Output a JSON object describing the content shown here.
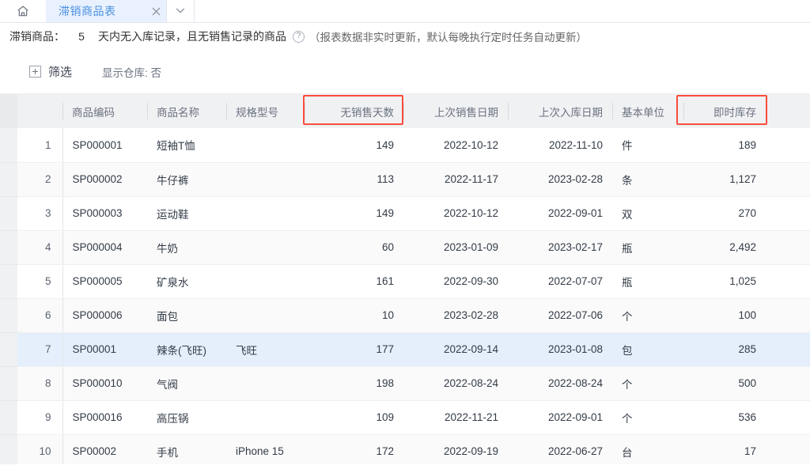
{
  "tabbar": {
    "home_icon": "home-icon",
    "active_tab": "滞销商品表",
    "close_icon": "close-icon",
    "dropdown_icon": "chevron-down-icon"
  },
  "description": {
    "label": "滞销商品：",
    "days_value": "5",
    "middle": "天内无入库记录，且无销售记录的商品",
    "help_icon": "help-circle-icon",
    "note": "（报表数据非实时更新，默认每晚执行定时任务自动更新）"
  },
  "toolbar": {
    "filter_icon": "plus-square-icon",
    "filter_label": "筛选",
    "warehouse_toggle": "显示仓库: 否"
  },
  "table": {
    "columns": [
      {
        "key": "rownum",
        "label": "",
        "align": "num"
      },
      {
        "key": "code",
        "label": "商品编码",
        "align": "left"
      },
      {
        "key": "name",
        "label": "商品名称",
        "align": "left"
      },
      {
        "key": "spec",
        "label": "规格型号",
        "align": "left"
      },
      {
        "key": "days",
        "label": "无销售天数",
        "align": "num"
      },
      {
        "key": "lastsale",
        "label": "上次销售日期",
        "align": "num"
      },
      {
        "key": "lastin",
        "label": "上次入库日期",
        "align": "num"
      },
      {
        "key": "unit",
        "label": "基本单位",
        "align": "left"
      },
      {
        "key": "stock",
        "label": "即时库存",
        "align": "num"
      },
      {
        "key": "tail",
        "label": "",
        "align": "left"
      }
    ],
    "highlighted_columns": [
      "无销售天数",
      "即时库存"
    ],
    "highlight_color": "#fa4d3d",
    "selected_row_index": 7,
    "rows": [
      {
        "rownum": "1",
        "code": "SP000001",
        "name": "短袖T恤",
        "spec": "",
        "days": "149",
        "lastsale": "2022-10-12",
        "lastin": "2022-11-10",
        "unit": "件",
        "stock": "189",
        "tail": ""
      },
      {
        "rownum": "2",
        "code": "SP000002",
        "name": "牛仔裤",
        "spec": "",
        "days": "113",
        "lastsale": "2022-11-17",
        "lastin": "2023-02-28",
        "unit": "条",
        "stock": "1,127",
        "tail": ""
      },
      {
        "rownum": "3",
        "code": "SP000003",
        "name": "运动鞋",
        "spec": "",
        "days": "149",
        "lastsale": "2022-10-12",
        "lastin": "2022-09-01",
        "unit": "双",
        "stock": "270",
        "tail": ""
      },
      {
        "rownum": "4",
        "code": "SP000004",
        "name": "牛奶",
        "spec": "",
        "days": "60",
        "lastsale": "2023-01-09",
        "lastin": "2023-02-17",
        "unit": "瓶",
        "stock": "2,492",
        "tail": ""
      },
      {
        "rownum": "5",
        "code": "SP000005",
        "name": "矿泉水",
        "spec": "",
        "days": "161",
        "lastsale": "2022-09-30",
        "lastin": "2022-07-07",
        "unit": "瓶",
        "stock": "1,025",
        "tail": ""
      },
      {
        "rownum": "6",
        "code": "SP000006",
        "name": "面包",
        "spec": "",
        "days": "10",
        "lastsale": "2023-02-28",
        "lastin": "2022-07-06",
        "unit": "个",
        "stock": "100",
        "tail": ""
      },
      {
        "rownum": "7",
        "code": "SP00001",
        "name": "辣条(飞旺)",
        "spec": "飞旺",
        "days": "177",
        "lastsale": "2022-09-14",
        "lastin": "2023-01-08",
        "unit": "包",
        "stock": "285",
        "tail": ""
      },
      {
        "rownum": "8",
        "code": "SP000010",
        "name": "气阀",
        "spec": "",
        "days": "198",
        "lastsale": "2022-08-24",
        "lastin": "2022-08-24",
        "unit": "个",
        "stock": "500",
        "tail": ""
      },
      {
        "rownum": "9",
        "code": "SP000016",
        "name": "高压锅",
        "spec": "",
        "days": "109",
        "lastsale": "2022-11-21",
        "lastin": "2022-09-01",
        "unit": "个",
        "stock": "536",
        "tail": ""
      },
      {
        "rownum": "10",
        "code": "SP00002",
        "name": "手机",
        "spec": "iPhone 15",
        "days": "172",
        "lastsale": "2022-09-19",
        "lastin": "2022-06-27",
        "unit": "台",
        "stock": "17",
        "tail": ""
      }
    ]
  }
}
